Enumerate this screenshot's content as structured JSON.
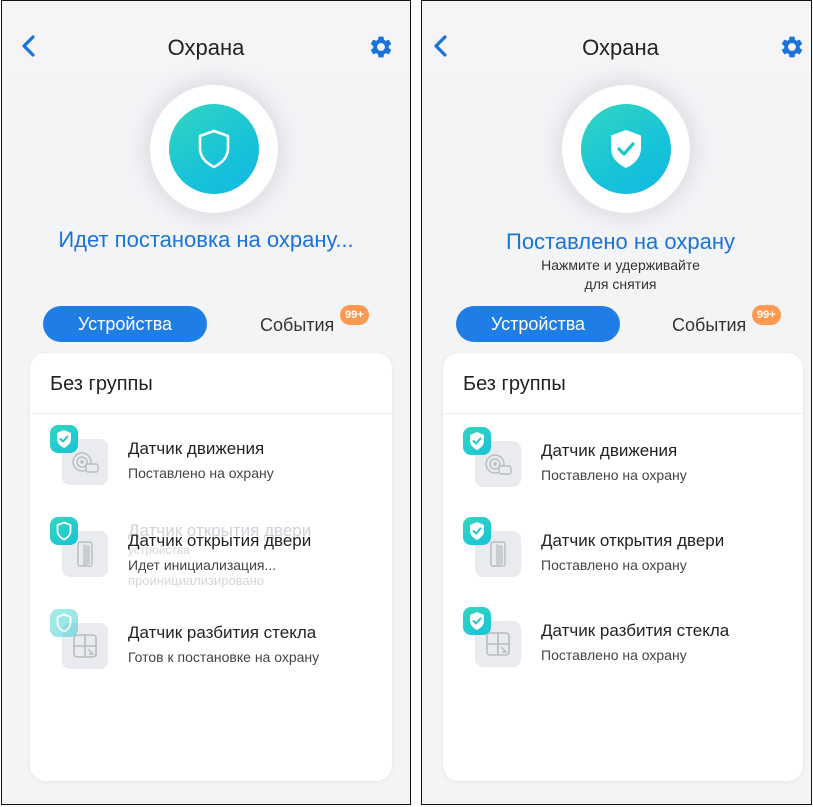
{
  "screens": [
    {
      "header": {
        "title": "Охрана"
      },
      "status": {
        "main": "Идет постановка на охрану..."
      },
      "tabs": {
        "devices_label": "Устройства",
        "events_label": "События",
        "events_badge": "99+"
      },
      "group": {
        "title": "Без группы"
      },
      "devices": [
        {
          "name": "Датчик движения",
          "status": "Поставлено на охрану"
        },
        {
          "name": "Датчик открытия двери",
          "status": "Идет инициализация...",
          "ghost_name": "Датчик открытия двери",
          "ghost_sub": "устройства",
          "ghost_status": "проинициализировано"
        },
        {
          "name": "Датчик разбития стекла",
          "status": "Готов к постановке на охрану"
        }
      ]
    },
    {
      "header": {
        "title": "Охрана"
      },
      "status": {
        "main": "Поставлено на охрану",
        "line1": "Нажмите и удерживайте",
        "line2": "для снятия"
      },
      "tabs": {
        "devices_label": "Устройства",
        "events_label": "События",
        "events_badge": "99+"
      },
      "group": {
        "title": "Без группы"
      },
      "devices": [
        {
          "name": "Датчик движения",
          "status": "Поставлено на охрану"
        },
        {
          "name": "Датчик открытия двери",
          "status": "Поставлено на охрану"
        },
        {
          "name": "Датчик разбития стекла",
          "status": "Поставлено на охрану"
        }
      ]
    }
  ],
  "colors": {
    "accent": "#1f7ee6",
    "status_text": "#1a73d9",
    "shield_gradient_start": "#33d6bf",
    "shield_gradient_end": "#17c3d9",
    "badge": "#ff9950"
  },
  "icons": [
    "back-arrow-icon",
    "gear-icon",
    "shield-icon",
    "shield-check-icon",
    "motion-sensor-icon",
    "door-sensor-icon",
    "glass-break-icon"
  ]
}
